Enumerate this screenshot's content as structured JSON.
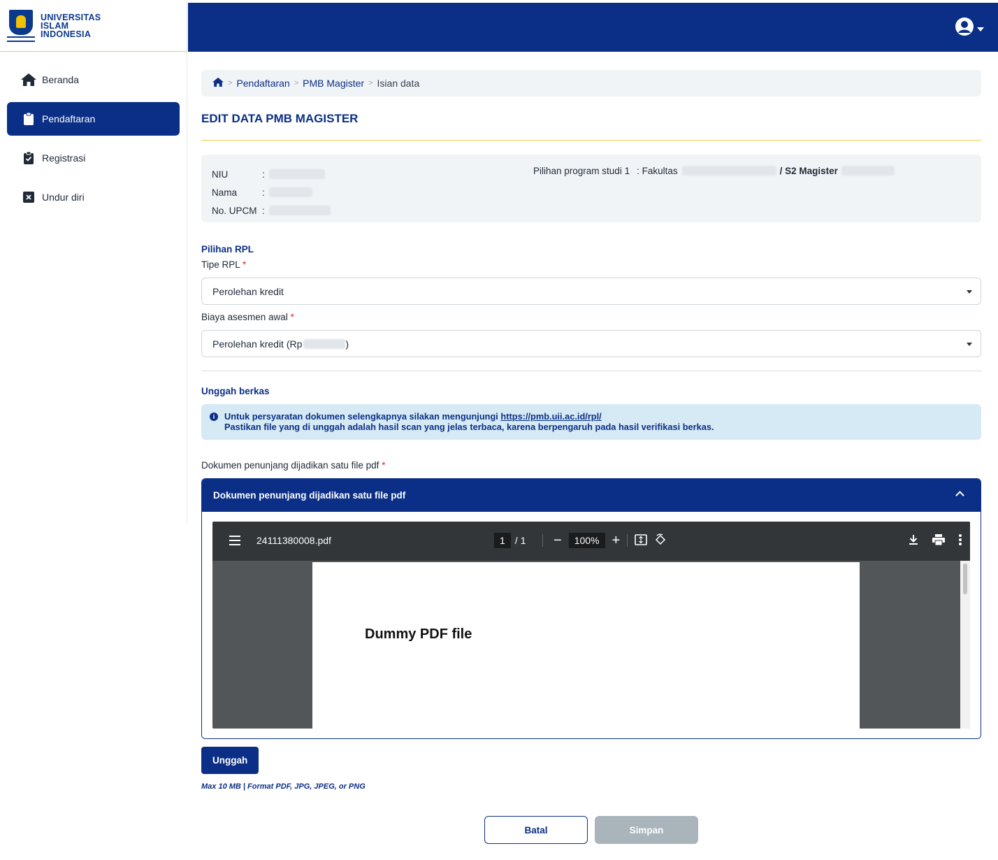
{
  "brand": {
    "line1": "UNIVERSITAS",
    "line2": "ISLAM",
    "line3": "INDONESIA"
  },
  "sidebar": {
    "items": [
      {
        "label": "Beranda",
        "icon": "home-icon"
      },
      {
        "label": "Pendaftaran",
        "icon": "clipboard-icon",
        "active": true
      },
      {
        "label": "Registrasi",
        "icon": "clipboard-check-icon"
      },
      {
        "label": "Undur diri",
        "icon": "close-box-icon"
      }
    ]
  },
  "breadcrumb": {
    "items": [
      "Pendaftaran",
      "PMB Magister"
    ],
    "current": "Isian data"
  },
  "page_title": "EDIT DATA PMB MAGISTER",
  "applicant": {
    "niu_label": "NIU",
    "nama_label": "Nama",
    "upcm_label": "No. UPCM",
    "colon": ":",
    "prodi_label": "Pilihan program studi 1",
    "prodi_prefix": ": Fakultas",
    "prodi_degree": "/ S2 Magister"
  },
  "rpl": {
    "section": "Pilihan RPL",
    "tipe_label": "Tipe RPL",
    "tipe_value": "Perolehan kredit",
    "biaya_label": "Biaya asesmen awal",
    "biaya_value_prefix": "Perolehan kredit (Rp",
    "biaya_value_suffix": ")",
    "required_mark": "*"
  },
  "upload": {
    "section": "Unggah berkas",
    "alert_line1": "Untuk persyaratan dokumen selengkapnya silakan mengunjungi",
    "alert_link": "https://pmb.uii.ac.id/rpl/",
    "alert_line2": "Pastikan file yang di unggah adalah hasil scan yang jelas terbaca, karena berpengaruh pada hasil verifikasi berkas.",
    "field_label": "Dokumen penunjang dijadikan satu file pdf",
    "accordion_title": "Dokumen penunjang dijadikan satu file pdf",
    "button": "Unggah",
    "hint": "Max 10 MB | Format PDF, JPG, JPEG, or PNG"
  },
  "pdf_viewer": {
    "filename": "24111380008.pdf",
    "page_current": "1",
    "page_total": "/ 1",
    "zoom": "100%",
    "page_text": "Dummy PDF file"
  },
  "actions": {
    "cancel": "Batal",
    "save": "Simpan"
  },
  "colors": {
    "primary": "#0b2f86",
    "accent": "#f2c94c",
    "alert_bg": "#d6eaf5",
    "disabled": "#a9b5bb"
  }
}
